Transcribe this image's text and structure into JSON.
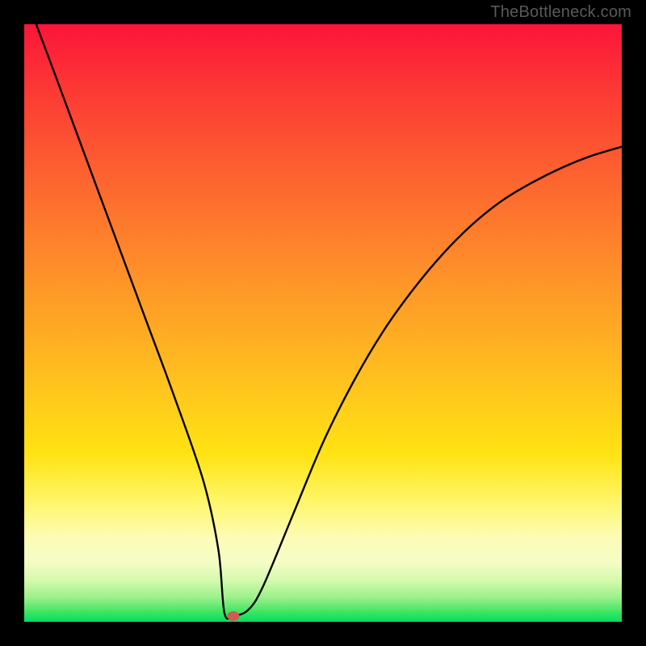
{
  "watermark": "TheBottleneck.com",
  "chart_data": {
    "type": "line",
    "title": "",
    "xlabel": "",
    "ylabel": "",
    "xlim": [
      0,
      100
    ],
    "ylim": [
      0,
      100
    ],
    "grid": false,
    "legend": false,
    "series": [
      {
        "name": "curve",
        "x": [
          2,
          5,
          10,
          15,
          20,
          25,
          30,
          32.5,
          33.5,
          35,
          37.5,
          40,
          45,
          50,
          55,
          60,
          65,
          70,
          75,
          80,
          85,
          90,
          95,
          100
        ],
        "values": [
          100,
          92,
          78.5,
          65,
          51.5,
          38,
          23.5,
          12,
          1.5,
          1,
          2,
          6,
          18,
          30,
          40,
          48.5,
          55.5,
          61.5,
          66.5,
          70.5,
          73.5,
          76,
          78,
          79.5
        ]
      }
    ],
    "marker": {
      "x": 35,
      "y": 1
    },
    "background_gradient": {
      "top_color": "#fb1539",
      "mid_color": "#ffe313",
      "bottom_color": "#00de66"
    }
  },
  "layout": {
    "image_size": 800,
    "plot_inset": 30
  }
}
